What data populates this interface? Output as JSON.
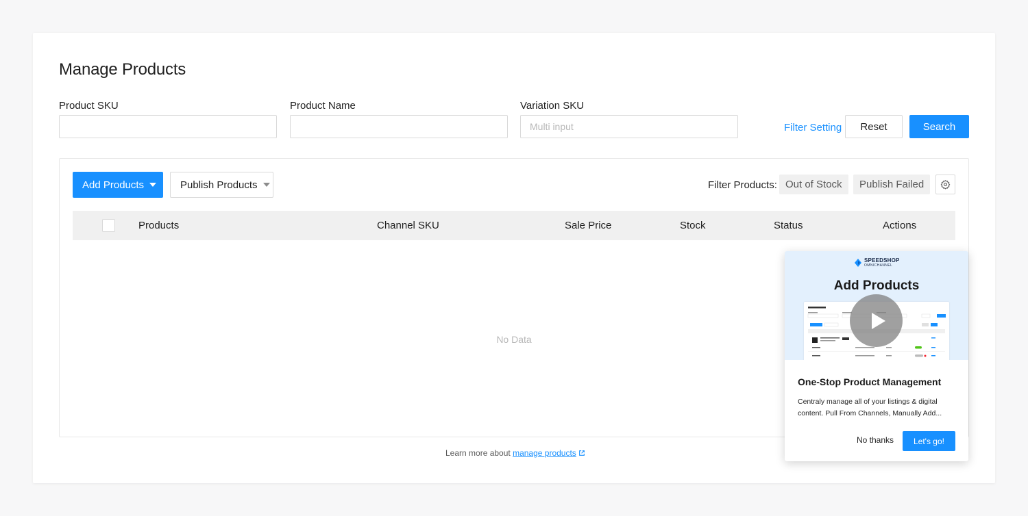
{
  "page": {
    "title": "Manage Products"
  },
  "filters": {
    "product_sku": {
      "label": "Product SKU",
      "value": "",
      "placeholder": ""
    },
    "product_name": {
      "label": "Product Name",
      "value": "",
      "placeholder": ""
    },
    "variation_sku": {
      "label": "Variation SKU",
      "value": "",
      "placeholder": "Multi input"
    },
    "filter_setting": "Filter Setting",
    "reset": "Reset",
    "search": "Search"
  },
  "toolbar": {
    "add_products": "Add Products",
    "publish_products": "Publish Products",
    "filter_products_label": "Filter Products:",
    "chips": [
      "Out of Stock",
      "Publish Failed"
    ]
  },
  "table": {
    "columns": [
      "Products",
      "Channel SKU",
      "Sale Price",
      "Stock",
      "Status",
      "Actions"
    ],
    "empty_text": "No Data"
  },
  "footer": {
    "learn_prefix": "Learn more about",
    "learn_link": "manage products"
  },
  "popup": {
    "brand_name": "SPEEDSHOP",
    "brand_sub": "OMNICHANNEL",
    "hero_title": "Add Products",
    "title": "One-Stop Product Management",
    "description": "Centraly manage all of your listings & digital content. Pull From Channels, Manually Add...",
    "no_thanks": "No thanks",
    "lets_go": "Let's go!"
  },
  "colors": {
    "primary": "#1890ff",
    "border": "#d9d9d9",
    "header_bg": "#f0f0f0",
    "hero_bg": "#e3f0fd"
  },
  "icons": [
    "caret-down-icon",
    "gear-icon",
    "external-link-icon",
    "play-icon",
    "speedshop-logo-icon"
  ]
}
